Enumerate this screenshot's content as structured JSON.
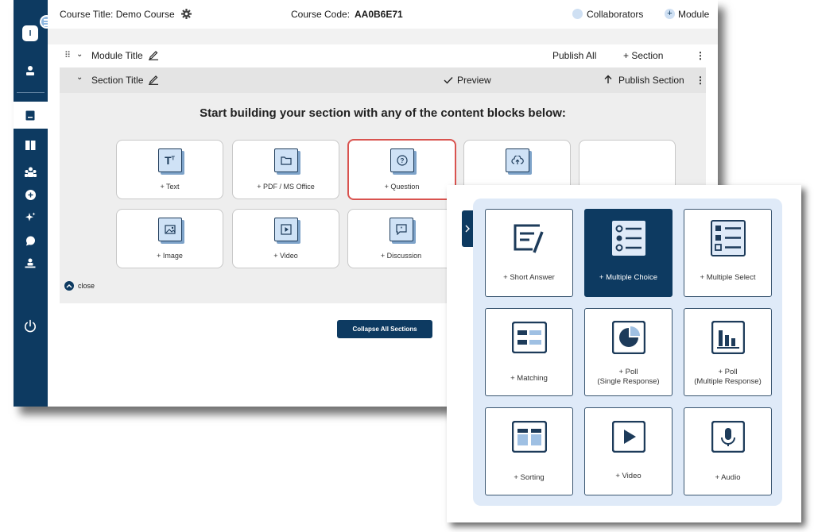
{
  "topbar": {
    "course_title": "Course Title: Demo Course",
    "course_code_label": "Course Code:",
    "course_code": "AA0B6E71",
    "collaborators": "Collaborators",
    "module": "Module"
  },
  "rail": {
    "badge": "I"
  },
  "module": {
    "title": "Module Title",
    "publish_all": "Publish All",
    "add_section": "+ Section"
  },
  "section": {
    "title": "Section Title",
    "preview": "Preview",
    "publish_section": "Publish Section",
    "heading": "Start building your section with any of the content blocks below:",
    "blocks": [
      {
        "label": "+ Text",
        "icon": "text-icon"
      },
      {
        "label": "+ PDF / MS Office",
        "icon": "folder-icon"
      },
      {
        "label": "+ Question",
        "icon": "question-icon"
      },
      {
        "label": "",
        "icon": "upload-icon"
      },
      {
        "label": "",
        "icon": "blank-icon"
      },
      {
        "label": "+ Image",
        "icon": "image-icon"
      },
      {
        "label": "+ Video",
        "icon": "video-icon"
      },
      {
        "label": "+ Discussion",
        "icon": "discussion-icon"
      }
    ],
    "close_label": "close"
  },
  "collapse_all": "Collapse All Sections",
  "question_types": [
    {
      "line1": "+ Short Answer",
      "line2": "",
      "icon": "short-answer-icon"
    },
    {
      "line1": "+ Multiple Choice",
      "line2": "",
      "icon": "multiple-choice-icon"
    },
    {
      "line1": "+ Multiple Select",
      "line2": "",
      "icon": "multiple-select-icon"
    },
    {
      "line1": "+ Matching",
      "line2": "",
      "icon": "matching-icon"
    },
    {
      "line1": "+ Poll",
      "line2": "(Single Response)",
      "icon": "pie-chart-icon"
    },
    {
      "line1": "+ Poll",
      "line2": "(Multiple Response)",
      "icon": "bar-chart-icon"
    },
    {
      "line1": "+ Sorting",
      "line2": "",
      "icon": "sorting-icon"
    },
    {
      "line1": "+ Video",
      "line2": "",
      "icon": "play-icon"
    },
    {
      "line1": "+ Audio",
      "line2": "",
      "icon": "microphone-icon"
    }
  ],
  "colors": {
    "navy": "#0d3a61",
    "light_blue": "#dfeaf8",
    "selected_border": "#d9534f"
  }
}
